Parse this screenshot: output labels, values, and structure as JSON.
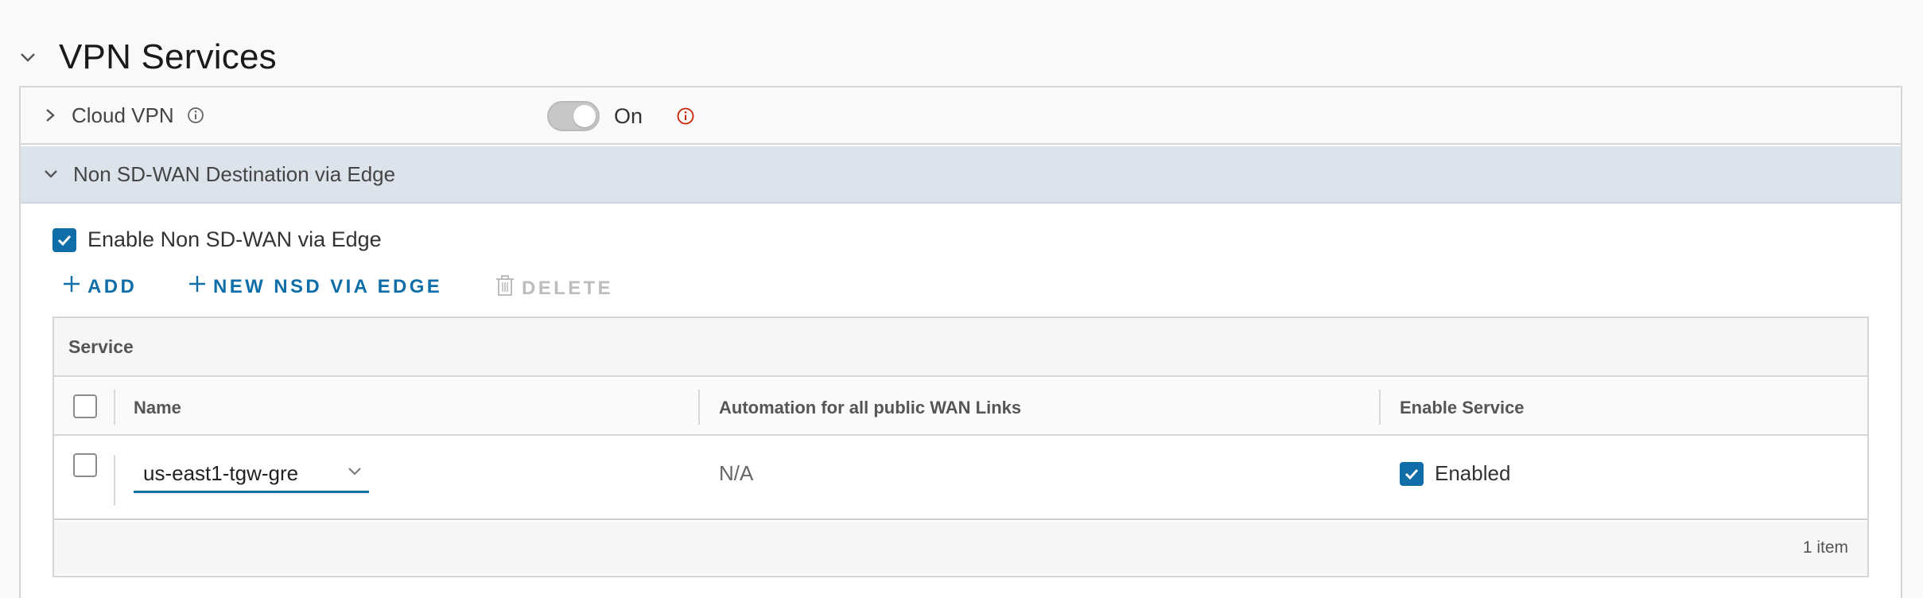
{
  "section": {
    "title": "VPN Services",
    "icon": "chevron-down-icon"
  },
  "cloud_vpn": {
    "label": "Cloud VPN",
    "toggle_state": "On",
    "toggle_on": true
  },
  "nsd": {
    "label": "Non SD-WAN Destination via Edge",
    "enable_checkbox_label": "Enable Non SD-WAN via Edge",
    "enable_checked": true,
    "actions": {
      "add": "ADD",
      "new": "NEW NSD VIA EDGE",
      "delete": "DELETE"
    }
  },
  "grid": {
    "title": "Service",
    "columns": {
      "name": "Name",
      "automation": "Automation for all public WAN Links",
      "enable": "Enable Service"
    },
    "rows": [
      {
        "name": "us-east1-tgw-gre",
        "automation": "N/A",
        "enable": "Enabled",
        "enabled": true,
        "selected": false
      }
    ],
    "footer": "1 item"
  },
  "colors": {
    "accent": "#0f6ea8",
    "warning": "#c92100",
    "header_band": "#dde3ea"
  }
}
